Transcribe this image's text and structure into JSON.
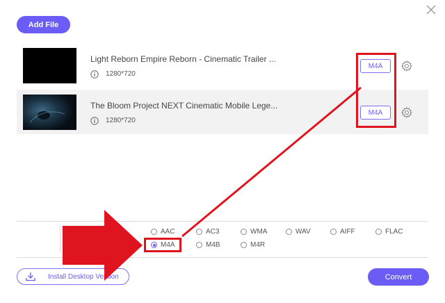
{
  "toolbar": {
    "add_file_label": "Add File"
  },
  "files": [
    {
      "name": "Light Reborn Empire Reborn - Cinematic Trailer ...",
      "resolution": "1280*720",
      "format": "M4A"
    },
    {
      "name": "The Bloom Project NEXT Cinematic Mobile Lege...",
      "resolution": "1280*720",
      "format": "M4A"
    }
  ],
  "formats": {
    "row1": [
      "AAC",
      "AC3",
      "WMA",
      "WAV",
      "AIFF",
      "FLAC"
    ],
    "row2": [
      "M4A",
      "M4B",
      "M4R"
    ],
    "selected": "M4A"
  },
  "footer": {
    "install_label": "Install Desktop Version",
    "convert_label": "Convert"
  },
  "colors": {
    "accent": "#6a5cf5",
    "annotation": "#e0141e"
  }
}
